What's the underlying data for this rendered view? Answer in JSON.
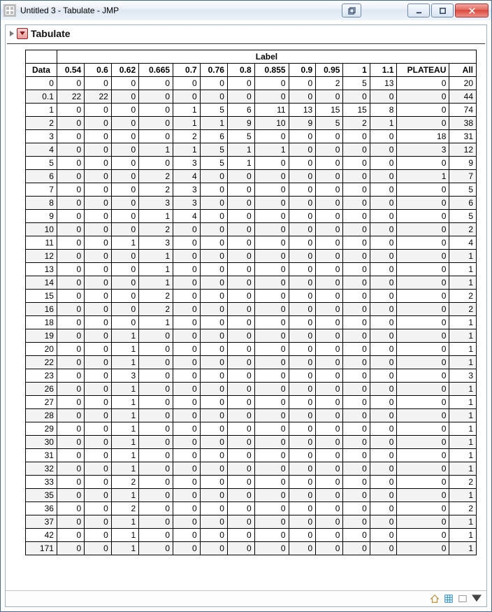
{
  "window": {
    "title": "Untitled 3 - Tabulate - JMP"
  },
  "section": {
    "title": "Tabulate"
  },
  "table": {
    "super_header": "Label",
    "row_header": "Data",
    "columns": [
      "0.54",
      "0.6",
      "0.62",
      "0.665",
      "0.7",
      "0.76",
      "0.8",
      "0.855",
      "0.9",
      "0.95",
      "1",
      "1.1",
      "PLATEAU",
      "All"
    ],
    "rows": [
      {
        "label": "0",
        "cells": [
          0,
          0,
          0,
          0,
          0,
          0,
          0,
          0,
          0,
          2,
          5,
          13,
          0,
          20
        ]
      },
      {
        "label": "0.1",
        "cells": [
          22,
          22,
          0,
          0,
          0,
          0,
          0,
          0,
          0,
          0,
          0,
          0,
          0,
          44
        ]
      },
      {
        "label": "1",
        "cells": [
          0,
          0,
          0,
          0,
          1,
          5,
          6,
          11,
          13,
          15,
          15,
          8,
          0,
          74
        ]
      },
      {
        "label": "2",
        "cells": [
          0,
          0,
          0,
          0,
          1,
          1,
          9,
          10,
          9,
          5,
          2,
          1,
          0,
          38
        ]
      },
      {
        "label": "3",
        "cells": [
          0,
          0,
          0,
          0,
          2,
          6,
          5,
          0,
          0,
          0,
          0,
          0,
          18,
          31
        ]
      },
      {
        "label": "4",
        "cells": [
          0,
          0,
          0,
          1,
          1,
          5,
          1,
          1,
          0,
          0,
          0,
          0,
          3,
          12
        ]
      },
      {
        "label": "5",
        "cells": [
          0,
          0,
          0,
          0,
          3,
          5,
          1,
          0,
          0,
          0,
          0,
          0,
          0,
          9
        ]
      },
      {
        "label": "6",
        "cells": [
          0,
          0,
          0,
          2,
          4,
          0,
          0,
          0,
          0,
          0,
          0,
          0,
          1,
          7
        ]
      },
      {
        "label": "7",
        "cells": [
          0,
          0,
          0,
          2,
          3,
          0,
          0,
          0,
          0,
          0,
          0,
          0,
          0,
          5
        ]
      },
      {
        "label": "8",
        "cells": [
          0,
          0,
          0,
          3,
          3,
          0,
          0,
          0,
          0,
          0,
          0,
          0,
          0,
          6
        ]
      },
      {
        "label": "9",
        "cells": [
          0,
          0,
          0,
          1,
          4,
          0,
          0,
          0,
          0,
          0,
          0,
          0,
          0,
          5
        ]
      },
      {
        "label": "10",
        "cells": [
          0,
          0,
          0,
          2,
          0,
          0,
          0,
          0,
          0,
          0,
          0,
          0,
          0,
          2
        ]
      },
      {
        "label": "11",
        "cells": [
          0,
          0,
          1,
          3,
          0,
          0,
          0,
          0,
          0,
          0,
          0,
          0,
          0,
          4
        ]
      },
      {
        "label": "12",
        "cells": [
          0,
          0,
          0,
          1,
          0,
          0,
          0,
          0,
          0,
          0,
          0,
          0,
          0,
          1
        ]
      },
      {
        "label": "13",
        "cells": [
          0,
          0,
          0,
          1,
          0,
          0,
          0,
          0,
          0,
          0,
          0,
          0,
          0,
          1
        ]
      },
      {
        "label": "14",
        "cells": [
          0,
          0,
          0,
          1,
          0,
          0,
          0,
          0,
          0,
          0,
          0,
          0,
          0,
          1
        ]
      },
      {
        "label": "15",
        "cells": [
          0,
          0,
          0,
          2,
          0,
          0,
          0,
          0,
          0,
          0,
          0,
          0,
          0,
          2
        ]
      },
      {
        "label": "16",
        "cells": [
          0,
          0,
          0,
          2,
          0,
          0,
          0,
          0,
          0,
          0,
          0,
          0,
          0,
          2
        ]
      },
      {
        "label": "18",
        "cells": [
          0,
          0,
          0,
          1,
          0,
          0,
          0,
          0,
          0,
          0,
          0,
          0,
          0,
          1
        ]
      },
      {
        "label": "19",
        "cells": [
          0,
          0,
          1,
          0,
          0,
          0,
          0,
          0,
          0,
          0,
          0,
          0,
          0,
          1
        ]
      },
      {
        "label": "20",
        "cells": [
          0,
          0,
          1,
          0,
          0,
          0,
          0,
          0,
          0,
          0,
          0,
          0,
          0,
          1
        ]
      },
      {
        "label": "22",
        "cells": [
          0,
          0,
          1,
          0,
          0,
          0,
          0,
          0,
          0,
          0,
          0,
          0,
          0,
          1
        ]
      },
      {
        "label": "23",
        "cells": [
          0,
          0,
          3,
          0,
          0,
          0,
          0,
          0,
          0,
          0,
          0,
          0,
          0,
          3
        ]
      },
      {
        "label": "26",
        "cells": [
          0,
          0,
          1,
          0,
          0,
          0,
          0,
          0,
          0,
          0,
          0,
          0,
          0,
          1
        ]
      },
      {
        "label": "27",
        "cells": [
          0,
          0,
          1,
          0,
          0,
          0,
          0,
          0,
          0,
          0,
          0,
          0,
          0,
          1
        ]
      },
      {
        "label": "28",
        "cells": [
          0,
          0,
          1,
          0,
          0,
          0,
          0,
          0,
          0,
          0,
          0,
          0,
          0,
          1
        ]
      },
      {
        "label": "29",
        "cells": [
          0,
          0,
          1,
          0,
          0,
          0,
          0,
          0,
          0,
          0,
          0,
          0,
          0,
          1
        ]
      },
      {
        "label": "30",
        "cells": [
          0,
          0,
          1,
          0,
          0,
          0,
          0,
          0,
          0,
          0,
          0,
          0,
          0,
          1
        ]
      },
      {
        "label": "31",
        "cells": [
          0,
          0,
          1,
          0,
          0,
          0,
          0,
          0,
          0,
          0,
          0,
          0,
          0,
          1
        ]
      },
      {
        "label": "32",
        "cells": [
          0,
          0,
          1,
          0,
          0,
          0,
          0,
          0,
          0,
          0,
          0,
          0,
          0,
          1
        ]
      },
      {
        "label": "33",
        "cells": [
          0,
          0,
          2,
          0,
          0,
          0,
          0,
          0,
          0,
          0,
          0,
          0,
          0,
          2
        ]
      },
      {
        "label": "35",
        "cells": [
          0,
          0,
          1,
          0,
          0,
          0,
          0,
          0,
          0,
          0,
          0,
          0,
          0,
          1
        ]
      },
      {
        "label": "36",
        "cells": [
          0,
          0,
          2,
          0,
          0,
          0,
          0,
          0,
          0,
          0,
          0,
          0,
          0,
          2
        ]
      },
      {
        "label": "37",
        "cells": [
          0,
          0,
          1,
          0,
          0,
          0,
          0,
          0,
          0,
          0,
          0,
          0,
          0,
          1
        ]
      },
      {
        "label": "42",
        "cells": [
          0,
          0,
          1,
          0,
          0,
          0,
          0,
          0,
          0,
          0,
          0,
          0,
          0,
          1
        ]
      },
      {
        "label": "171",
        "cells": [
          0,
          0,
          1,
          0,
          0,
          0,
          0,
          0,
          0,
          0,
          0,
          0,
          0,
          1
        ]
      }
    ]
  },
  "chart_data": {
    "type": "table",
    "title": "Tabulate",
    "row_variable": "Data",
    "column_variable": "Label",
    "categories": [
      "0.54",
      "0.6",
      "0.62",
      "0.665",
      "0.7",
      "0.76",
      "0.8",
      "0.855",
      "0.9",
      "0.95",
      "1",
      "1.1",
      "PLATEAU",
      "All"
    ],
    "rows": [
      "0",
      "0.1",
      "1",
      "2",
      "3",
      "4",
      "5",
      "6",
      "7",
      "8",
      "9",
      "10",
      "11",
      "12",
      "13",
      "14",
      "15",
      "16",
      "18",
      "19",
      "20",
      "22",
      "23",
      "26",
      "27",
      "28",
      "29",
      "30",
      "31",
      "32",
      "33",
      "35",
      "36",
      "37",
      "42",
      "171"
    ],
    "values": [
      [
        0,
        0,
        0,
        0,
        0,
        0,
        0,
        0,
        0,
        2,
        5,
        13,
        0,
        20
      ],
      [
        22,
        22,
        0,
        0,
        0,
        0,
        0,
        0,
        0,
        0,
        0,
        0,
        0,
        44
      ],
      [
        0,
        0,
        0,
        0,
        1,
        5,
        6,
        11,
        13,
        15,
        15,
        8,
        0,
        74
      ],
      [
        0,
        0,
        0,
        0,
        1,
        1,
        9,
        10,
        9,
        5,
        2,
        1,
        0,
        38
      ],
      [
        0,
        0,
        0,
        0,
        2,
        6,
        5,
        0,
        0,
        0,
        0,
        0,
        18,
        31
      ],
      [
        0,
        0,
        0,
        1,
        1,
        5,
        1,
        1,
        0,
        0,
        0,
        0,
        3,
        12
      ],
      [
        0,
        0,
        0,
        0,
        3,
        5,
        1,
        0,
        0,
        0,
        0,
        0,
        0,
        9
      ],
      [
        0,
        0,
        0,
        2,
        4,
        0,
        0,
        0,
        0,
        0,
        0,
        0,
        1,
        7
      ],
      [
        0,
        0,
        0,
        2,
        3,
        0,
        0,
        0,
        0,
        0,
        0,
        0,
        0,
        5
      ],
      [
        0,
        0,
        0,
        3,
        3,
        0,
        0,
        0,
        0,
        0,
        0,
        0,
        0,
        6
      ],
      [
        0,
        0,
        0,
        1,
        4,
        0,
        0,
        0,
        0,
        0,
        0,
        0,
        0,
        5
      ],
      [
        0,
        0,
        0,
        2,
        0,
        0,
        0,
        0,
        0,
        0,
        0,
        0,
        0,
        2
      ],
      [
        0,
        0,
        1,
        3,
        0,
        0,
        0,
        0,
        0,
        0,
        0,
        0,
        0,
        4
      ],
      [
        0,
        0,
        0,
        1,
        0,
        0,
        0,
        0,
        0,
        0,
        0,
        0,
        0,
        1
      ],
      [
        0,
        0,
        0,
        1,
        0,
        0,
        0,
        0,
        0,
        0,
        0,
        0,
        0,
        1
      ],
      [
        0,
        0,
        0,
        1,
        0,
        0,
        0,
        0,
        0,
        0,
        0,
        0,
        0,
        1
      ],
      [
        0,
        0,
        0,
        2,
        0,
        0,
        0,
        0,
        0,
        0,
        0,
        0,
        0,
        2
      ],
      [
        0,
        0,
        0,
        2,
        0,
        0,
        0,
        0,
        0,
        0,
        0,
        0,
        0,
        2
      ],
      [
        0,
        0,
        0,
        1,
        0,
        0,
        0,
        0,
        0,
        0,
        0,
        0,
        0,
        1
      ],
      [
        0,
        0,
        1,
        0,
        0,
        0,
        0,
        0,
        0,
        0,
        0,
        0,
        0,
        1
      ],
      [
        0,
        0,
        1,
        0,
        0,
        0,
        0,
        0,
        0,
        0,
        0,
        0,
        0,
        1
      ],
      [
        0,
        0,
        1,
        0,
        0,
        0,
        0,
        0,
        0,
        0,
        0,
        0,
        0,
        1
      ],
      [
        0,
        0,
        3,
        0,
        0,
        0,
        0,
        0,
        0,
        0,
        0,
        0,
        0,
        3
      ],
      [
        0,
        0,
        1,
        0,
        0,
        0,
        0,
        0,
        0,
        0,
        0,
        0,
        0,
        1
      ],
      [
        0,
        0,
        1,
        0,
        0,
        0,
        0,
        0,
        0,
        0,
        0,
        0,
        0,
        1
      ],
      [
        0,
        0,
        1,
        0,
        0,
        0,
        0,
        0,
        0,
        0,
        0,
        0,
        0,
        1
      ],
      [
        0,
        0,
        1,
        0,
        0,
        0,
        0,
        0,
        0,
        0,
        0,
        0,
        0,
        1
      ],
      [
        0,
        0,
        1,
        0,
        0,
        0,
        0,
        0,
        0,
        0,
        0,
        0,
        0,
        1
      ],
      [
        0,
        0,
        1,
        0,
        0,
        0,
        0,
        0,
        0,
        0,
        0,
        0,
        0,
        1
      ],
      [
        0,
        0,
        1,
        0,
        0,
        0,
        0,
        0,
        0,
        0,
        0,
        0,
        0,
        1
      ],
      [
        0,
        0,
        2,
        0,
        0,
        0,
        0,
        0,
        0,
        0,
        0,
        0,
        0,
        2
      ],
      [
        0,
        0,
        1,
        0,
        0,
        0,
        0,
        0,
        0,
        0,
        0,
        0,
        0,
        1
      ],
      [
        0,
        0,
        2,
        0,
        0,
        0,
        0,
        0,
        0,
        0,
        0,
        0,
        0,
        2
      ],
      [
        0,
        0,
        1,
        0,
        0,
        0,
        0,
        0,
        0,
        0,
        0,
        0,
        0,
        1
      ],
      [
        0,
        0,
        1,
        0,
        0,
        0,
        0,
        0,
        0,
        0,
        0,
        0,
        0,
        1
      ],
      [
        0,
        0,
        1,
        0,
        0,
        0,
        0,
        0,
        0,
        0,
        0,
        0,
        0,
        1
      ]
    ]
  }
}
